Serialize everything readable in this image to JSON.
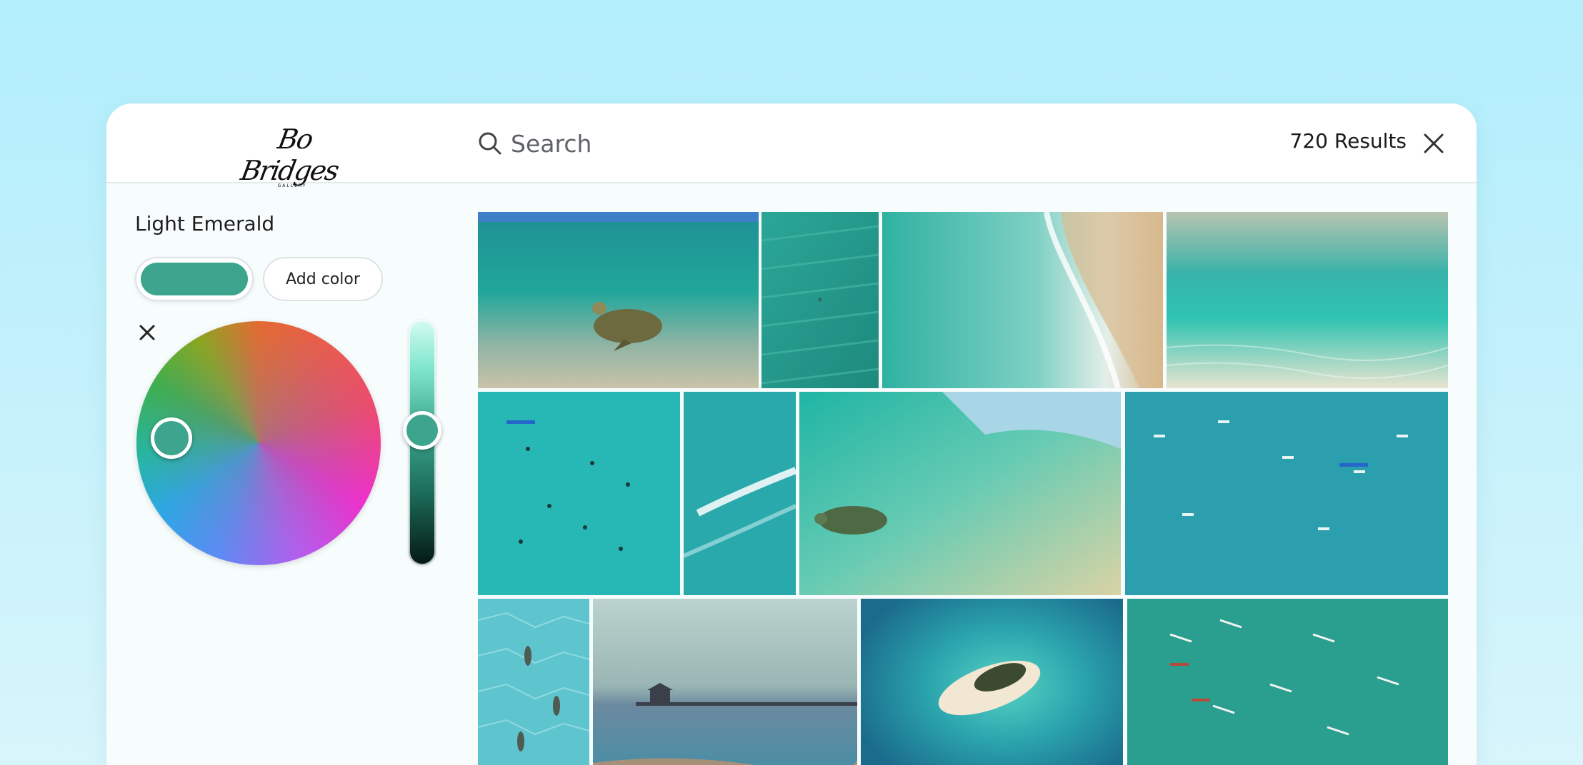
{
  "header": {
    "logo_text": "Bo Bridges",
    "logo_sub": "GALLERY",
    "search_placeholder": "Search",
    "results_text": "720 Results"
  },
  "sidebar": {
    "color_name": "Light Emerald",
    "selected_color": "#3da58e",
    "add_color_label": "Add color"
  },
  "icons": {
    "search": "search-icon",
    "close": "close-icon",
    "clear": "clear-icon"
  },
  "gallery": {
    "photos": [
      {
        "subject": "sea turtle underwater"
      },
      {
        "subject": "starfish on sand ripples"
      },
      {
        "subject": "aerial shoreline waves"
      },
      {
        "subject": "underwater sandy shallows"
      },
      {
        "subject": "aerial surfers turquoise water"
      },
      {
        "subject": "aerial breaking wave"
      },
      {
        "subject": "sea turtle in wave"
      },
      {
        "subject": "aerial paddle boarders"
      },
      {
        "subject": "sharks in shallow water"
      },
      {
        "subject": "pier at sunset"
      },
      {
        "subject": "aerial sandbar island"
      },
      {
        "subject": "aerial outrigger boats"
      }
    ]
  }
}
